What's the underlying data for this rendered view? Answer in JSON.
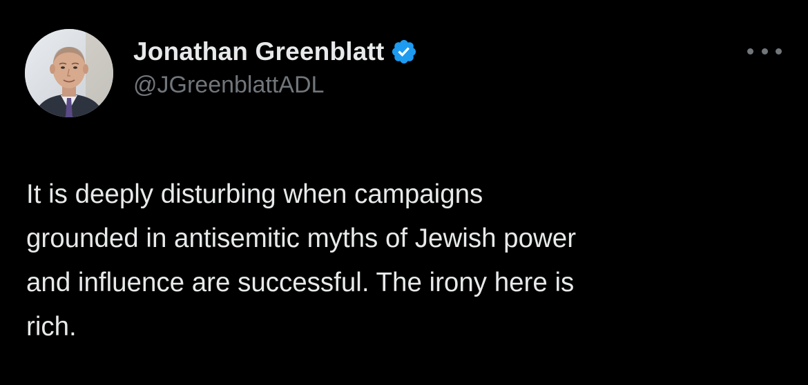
{
  "author": {
    "display_name": "Jonathan Greenblatt",
    "handle": "@JGreenblattADL",
    "verified": true,
    "avatar_icon": "profile-photo"
  },
  "menu": {
    "icon": "more-horizontal-icon"
  },
  "tweet": {
    "lines": [
      "It is deeply disturbing when campaigns",
      "grounded in antisemitic myths of Jewish power",
      "and influence are successful. The irony here is",
      "rich."
    ]
  },
  "colors": {
    "background": "#000000",
    "primary_text": "#e7e9ea",
    "secondary_text": "#71767b",
    "verified_badge": "#1d9bf0"
  }
}
